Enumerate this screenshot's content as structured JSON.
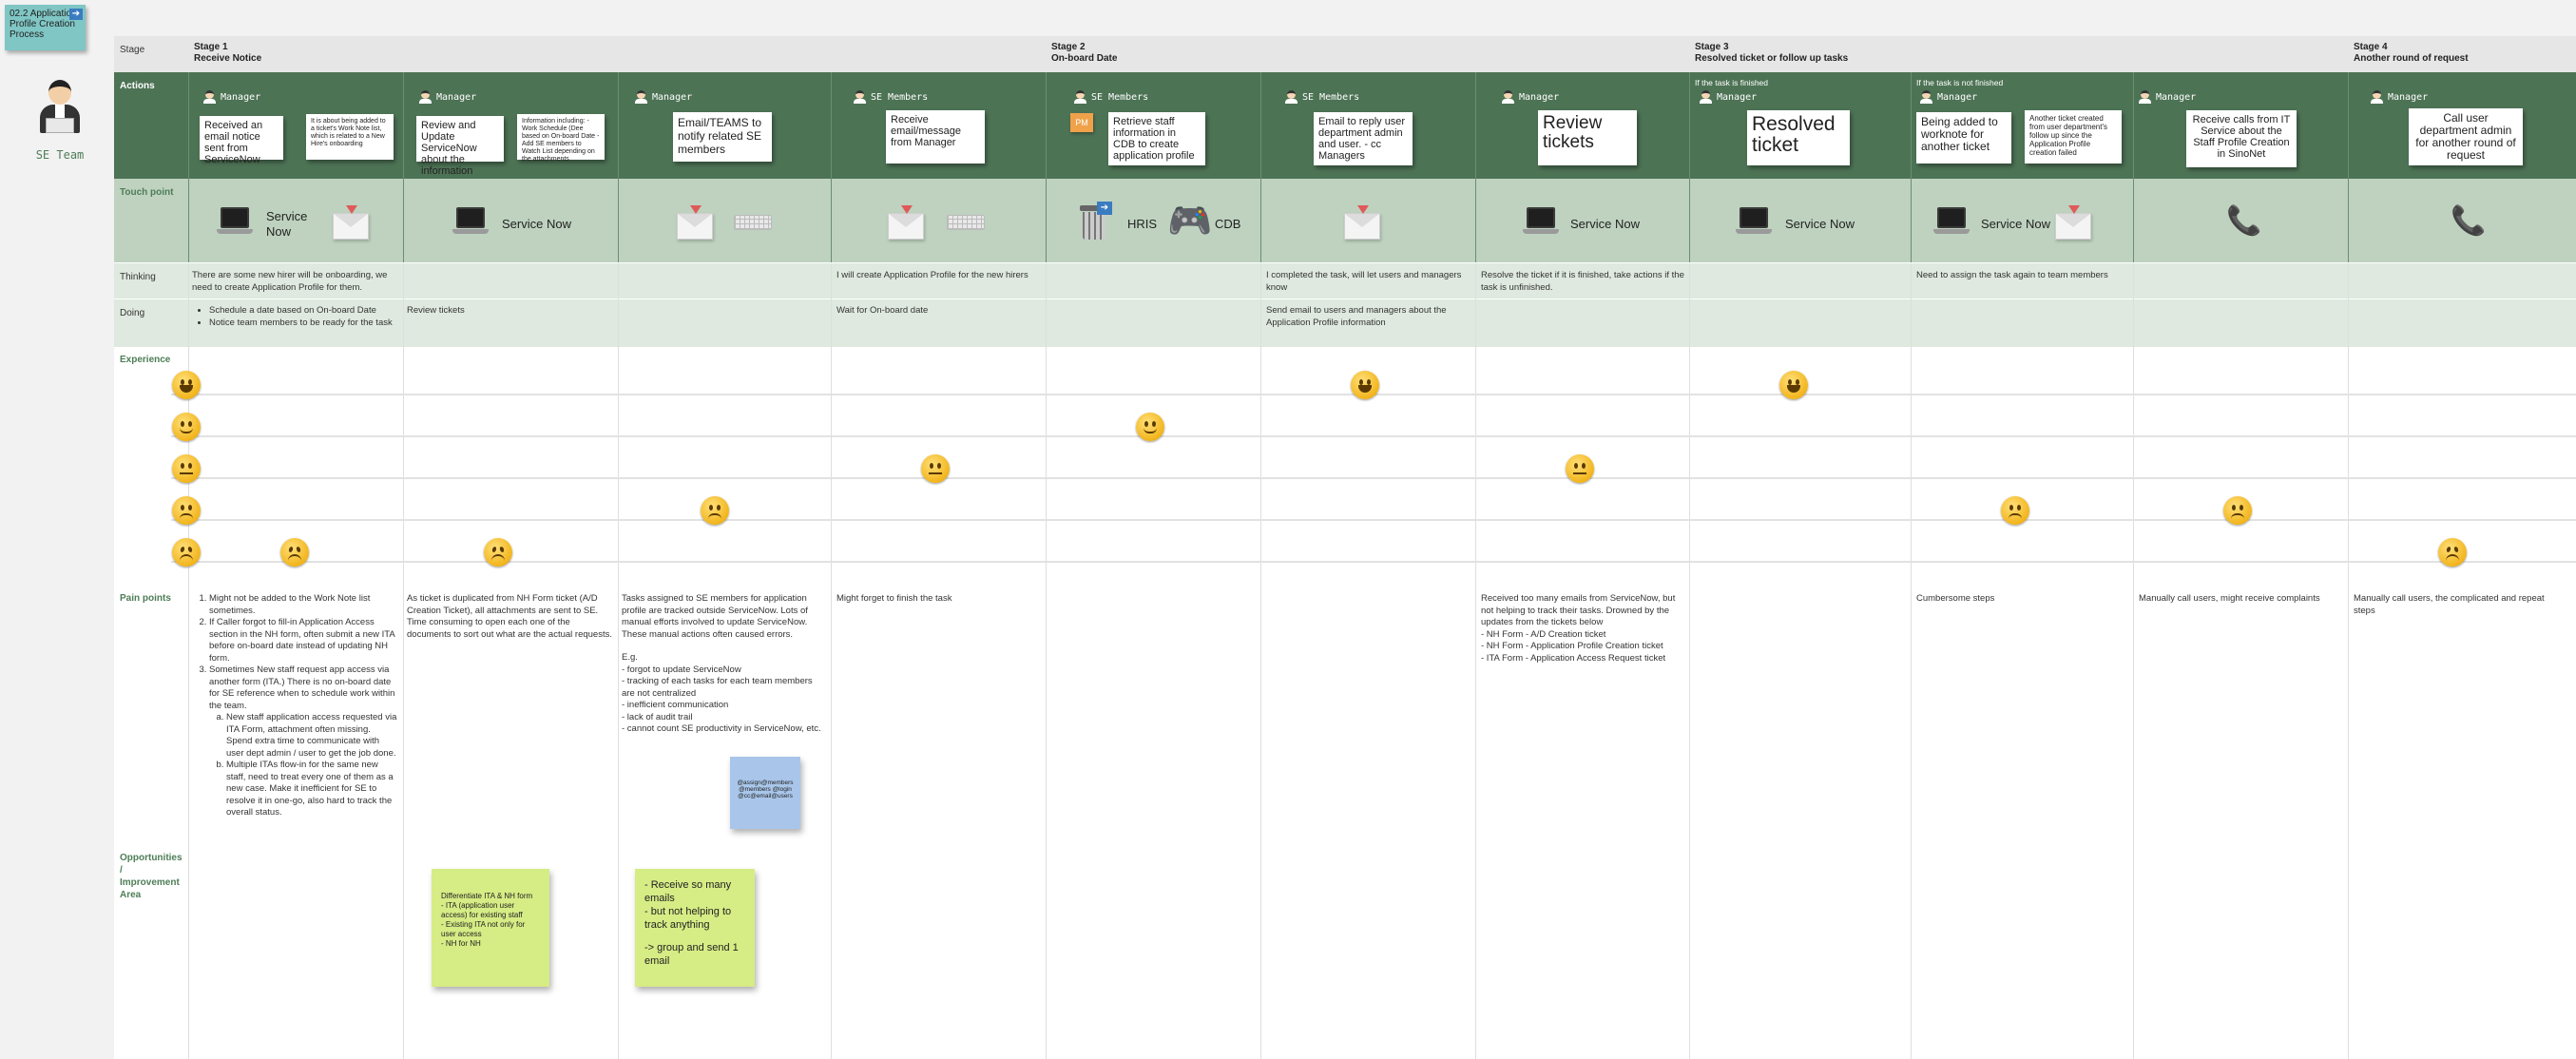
{
  "persona": {
    "name": "SE Team",
    "tag_title": "02.2 Application Profile Creation Process"
  },
  "row_labels": {
    "stage": "Stage",
    "actions": "Actions",
    "touchpoint": "Touch point",
    "thinking": "Thinking",
    "doing": "Doing",
    "experience": "Experience",
    "pain": "Pain points",
    "opp": "Opportunities / Improvement Area"
  },
  "stages": [
    {
      "label": "Stage 1",
      "title": "Receive Notice"
    },
    {
      "label": "Stage 2",
      "title": "On-board Date"
    },
    {
      "label": "Stage 3",
      "title": "Resolved ticket or follow up tasks"
    },
    {
      "label": "Stage 4",
      "title": "Another round of request"
    }
  ],
  "actions": [
    {
      "role": "Manager",
      "notes": [
        "Received an email notice sent from ServiceNow",
        "It is about being added to a ticket's Work Note list, which is related to a New Hire's onboarding"
      ]
    },
    {
      "role": "Manager",
      "notes": [
        "Review and Update ServiceNow about the information",
        "Information including: - Work Schedule (Dee based on On-board Date - Add SE members to Watch List depending on the attachments"
      ]
    },
    {
      "role": "Manager",
      "notes": [
        "Email/TEAMS to notify related SE members"
      ]
    },
    {
      "role": "SE Members",
      "notes": [
        "Receive email/message from Manager"
      ]
    },
    {
      "role": "SE Members",
      "notes": [
        "Retrieve staff information in CDB to create application profile"
      ],
      "badge": "PM"
    },
    {
      "role": "SE Members",
      "notes": [
        "Email to reply user department admin and user. - cc Managers"
      ]
    },
    {
      "role": "Manager",
      "notes": [
        "Review tickets"
      ]
    },
    {
      "role": "Manager",
      "pre": "If the task is finished",
      "notes": [
        "Resolved ticket"
      ]
    },
    {
      "role": "Manager",
      "pre": "If the task is not finished",
      "notes": [
        "Being added to worknote for another ticket",
        "Another ticket created from user department's follow up since the Application Profile creation failed"
      ]
    },
    {
      "role": "Manager",
      "notes": [
        "Receive calls from IT Service about the Staff Profile Creation in SinoNet"
      ]
    },
    {
      "role": "Manager",
      "notes": [
        "Call user department admin for another round of request"
      ]
    }
  ],
  "touchpoints": {
    "servicenow": "Service Now",
    "service_now_split": [
      "Service",
      "Now"
    ],
    "hris": "HRIS",
    "cdb": "CDB"
  },
  "thinking": {
    "c0": "There are some new hirer will be onboarding, we need to create Application Profile for them.",
    "c3": "I will create Application Profile for the new hirers",
    "c5": "I completed the task, will let users and managers know",
    "c6": "Resolve the ticket if it is finished, take actions if the task is unfinished.",
    "c8": "Need to assign the task again to team members"
  },
  "doing": {
    "c0": [
      "Schedule a date based on On-board Date",
      "Notice team members to be ready for the task"
    ],
    "c1": "Review tickets",
    "c3": "Wait for On-board date",
    "c5": "Send email to users and managers about the Application Profile information"
  },
  "experience": {
    "levels": [
      "very happy",
      "happy",
      "neutral",
      "unhappy",
      "sad"
    ],
    "points": [
      {
        "col": 0,
        "level": "sad"
      },
      {
        "col": 1,
        "level": "sad"
      },
      {
        "col": 2,
        "level": "unhappy"
      },
      {
        "col": 3,
        "level": "neutral"
      },
      {
        "col": 4,
        "level": "happy"
      },
      {
        "col": 5,
        "level": "very happy"
      },
      {
        "col": 6,
        "level": "neutral"
      },
      {
        "col": 7,
        "level": "very happy"
      },
      {
        "col": 8,
        "level": "unhappy"
      },
      {
        "col": 9,
        "level": "unhappy"
      },
      {
        "col": 10,
        "level": "sad"
      }
    ]
  },
  "pain": {
    "c0": [
      "Might not be added to the Work Note list sometimes.",
      "If Caller forgot to fill-in Application Access section in the NH form, often submit a new ITA before on-board date instead of updating NH form.",
      "Sometimes New staff request app access via another form (ITA.) There is no on-board date for SE reference when to schedule work within the team."
    ],
    "c0_sub": [
      "New staff application access requested via ITA Form, attachment often missing. Spend extra time to communicate with user dept admin / user to get the job done.",
      "Multiple ITAs flow-in for the same new staff, need to treat every one of them as a new case. Make it inefficient for SE to resolve it in one-go, also hard to track the overall status."
    ],
    "c1": "As ticket is duplicated from NH Form ticket (A/D Creation Ticket), all attachments are sent to SE. Time consuming to open each one of the documents to sort out what are the actual requests.",
    "c2": [
      "Tasks assigned to SE members for application profile are tracked outside ServiceNow. Lots of manual efforts involved to update ServiceNow. These manual actions often caused errors.",
      "",
      "E.g.",
      "- forgot to update ServiceNow",
      "- tracking of each tasks for each team members are not centralized",
      "- inefficient communication",
      "- lack of audit trail",
      "- cannot count SE productivity in ServiceNow, etc."
    ],
    "c2_sticky": "@assign@members @members @login @cc@email@users",
    "c3": "Might forget to finish the task",
    "c6": [
      "Received too many emails from ServiceNow, but not helping to track their tasks. Drowned by the updates from the tickets below",
      "- NH Form - A/D Creation ticket",
      "- NH Form - Application Profile Creation ticket",
      "- ITA Form - Application Access Request ticket"
    ],
    "c8": "Cumbersome steps",
    "c9": "Manually call users, might receive complaints",
    "c10": "Manually call users, the complicated and repeat steps"
  },
  "opportunities": {
    "s1": [
      "Differentiate ITA & NH form",
      "- ITA (application user access) for existing staff",
      "- Existing ITA not only for user access",
      "- NH for NH"
    ],
    "s2": [
      "- Receive so many emails",
      "- but not helping to track anything",
      "",
      "-> group and send 1 email"
    ]
  },
  "colors": {
    "action_bg": "#4d7355",
    "touch_bg": "#bed2bf",
    "think_bg": "#dfe9df",
    "label": "#4e7d57",
    "sticky_green": "#d6ec85",
    "sticky_blue": "#a9c6ea",
    "tag": "#7fc6c4"
  }
}
